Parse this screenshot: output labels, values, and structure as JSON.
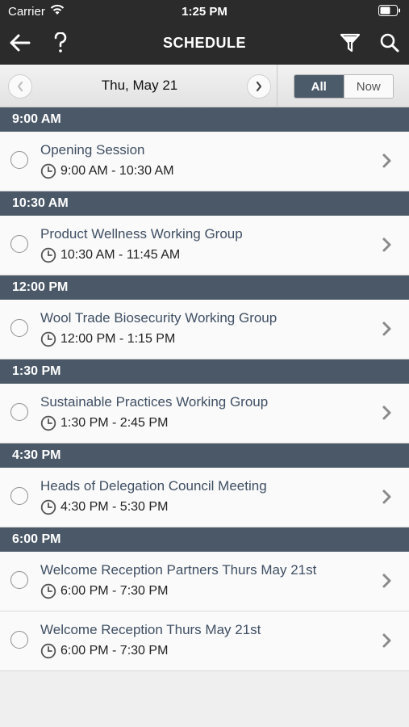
{
  "status_bar": {
    "carrier": "Carrier",
    "time": "1:25 PM"
  },
  "header": {
    "title": "SCHEDULE"
  },
  "date_bar": {
    "date": "Thu, May 21",
    "filter_all": "All",
    "filter_now": "Now",
    "selected_filter": "All"
  },
  "sections": [
    {
      "time": "9:00 AM",
      "items": [
        {
          "title": "Opening Session",
          "time": "9:00 AM - 10:30 AM"
        }
      ]
    },
    {
      "time": "10:30 AM",
      "items": [
        {
          "title": "Product Wellness Working Group",
          "time": "10:30 AM - 11:45 AM"
        }
      ]
    },
    {
      "time": "12:00 PM",
      "items": [
        {
          "title": "Wool Trade Biosecurity Working Group",
          "time": "12:00 PM - 1:15 PM"
        }
      ]
    },
    {
      "time": "1:30 PM",
      "items": [
        {
          "title": "Sustainable Practices Working Group",
          "time": "1:30 PM - 2:45 PM"
        }
      ]
    },
    {
      "time": "4:30 PM",
      "items": [
        {
          "title": "Heads of Delegation Council Meeting",
          "time": "4:30 PM - 5:30 PM"
        }
      ]
    },
    {
      "time": "6:00 PM",
      "items": [
        {
          "title": "Welcome Reception Partners Thurs May 21st",
          "time": "6:00 PM - 7:30 PM"
        },
        {
          "title": "Welcome Reception Thurs May 21st",
          "time": "6:00 PM - 7:30 PM"
        }
      ]
    }
  ],
  "colors": {
    "section_header": "#4a5867",
    "topbar": "#2b2b2b",
    "title_text": "#3f4f63",
    "segment_active": "#4c5b6a"
  }
}
